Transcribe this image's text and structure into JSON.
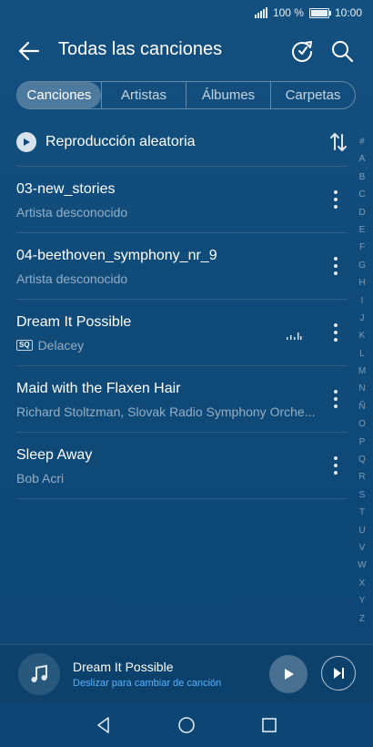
{
  "status_bar": {
    "battery": "100 %",
    "time": "10:00"
  },
  "header": {
    "title": "Todas las canciones",
    "icons": [
      "back-arrow-icon",
      "refresh-icon",
      "search-icon"
    ]
  },
  "tabs": [
    {
      "label": "Canciones",
      "active": true
    },
    {
      "label": "Artistas",
      "active": false
    },
    {
      "label": "Álbumes",
      "active": false
    },
    {
      "label": "Carpetas",
      "active": false
    }
  ],
  "shuffle": {
    "label": "Reproducción aleatoria"
  },
  "songs": [
    {
      "title": "03-new_stories",
      "artist": "Artista desconocido"
    },
    {
      "title": "04-beethoven_symphony_nr_9",
      "artist": "Artista desconocido"
    },
    {
      "title": "Dream It Possible",
      "artist": "Delacey",
      "badge": "SQ",
      "playing": true
    },
    {
      "title": "Maid with the Flaxen Hair",
      "artist": "Richard Stoltzman, Slovak Radio Symphony Orche..."
    },
    {
      "title": "Sleep Away",
      "artist": "Bob Acri"
    }
  ],
  "alpha_index": [
    "#",
    "A",
    "B",
    "C",
    "D",
    "E",
    "F",
    "G",
    "H",
    "I",
    "J",
    "K",
    "L",
    "M",
    "N",
    "Ñ",
    "O",
    "P",
    "Q",
    "R",
    "S",
    "T",
    "U",
    "V",
    "W",
    "X",
    "Y",
    "Z"
  ],
  "player": {
    "title": "Dream It Possible",
    "hint": "Deslizar para cambiar de canción"
  },
  "colors": {
    "background": "#0f4a79",
    "accent": "#58b2ff"
  }
}
